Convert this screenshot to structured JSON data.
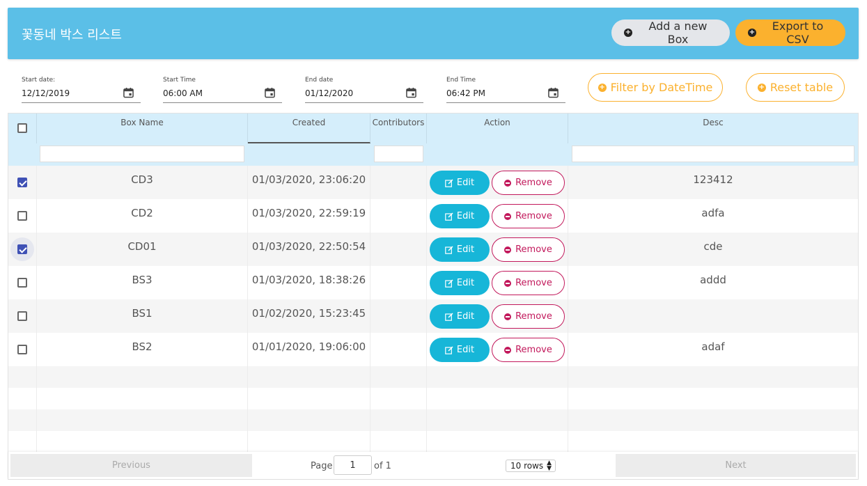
{
  "header": {
    "title": "꽃동네 박스 리스트",
    "add_label": "Add a new Box",
    "export_label": "Export to CSV"
  },
  "filters": {
    "start_date_label": "Start date:",
    "start_date_value": "12/12/2019",
    "start_time_label": "Start Time",
    "start_time_value": "06:00 AM",
    "end_date_label": "End date",
    "end_date_value": "01/12/2020",
    "end_time_label": "End Time",
    "end_time_value": "06:42 PM",
    "filter_label": "Filter by DateTime",
    "reset_label": "Reset table"
  },
  "table": {
    "columns": [
      "Box Name",
      "Created",
      "Contributors",
      "Action",
      "Desc"
    ],
    "edit_label": "Edit",
    "remove_label": "Remove",
    "rows": [
      {
        "name": "CD3",
        "created": "01/03/2020, 23:06:20",
        "desc": "123412",
        "checked": true
      },
      {
        "name": "CD2",
        "created": "01/03/2020, 22:59:19",
        "desc": "adfa",
        "checked": false
      },
      {
        "name": "CD01",
        "created": "01/03/2020, 22:50:54",
        "desc": "cde",
        "checked": true
      },
      {
        "name": "BS3",
        "created": "01/03/2020, 18:38:26",
        "desc": "addd",
        "checked": false
      },
      {
        "name": "BS1",
        "created": "01/02/2020, 15:23:45",
        "desc": "",
        "checked": false
      },
      {
        "name": "BS2",
        "created": "01/01/2020, 19:06:00",
        "desc": "adaf",
        "checked": false
      }
    ]
  },
  "pagination": {
    "previous_label": "Previous",
    "next_label": "Next",
    "page_label": "Page",
    "page_value": "1",
    "of_label": "of 1",
    "rows_option": "10 rows"
  },
  "colors": {
    "header_bg": "#5bbfe7",
    "accent_orange": "#fbb12e",
    "edit_blue": "#17b6d8",
    "remove_red": "#c2185b",
    "checkbox_blue": "#3f51b5"
  }
}
